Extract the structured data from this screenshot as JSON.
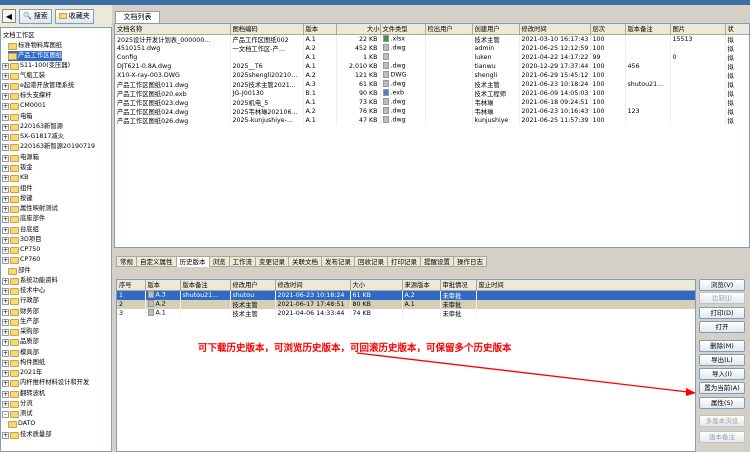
{
  "toolbar": {
    "search_label": "搜索",
    "favorites_label": "收藏夹"
  },
  "tree": [
    {
      "label": "文档工作区",
      "level": 0,
      "expander": "",
      "folder": false
    },
    {
      "label": "标准物料库图纸",
      "level": 1,
      "expander": "",
      "folder": true
    },
    {
      "label": "产品工作区图纸",
      "level": 1,
      "expander": "",
      "folder": true,
      "selected": true
    },
    {
      "label": "S11-100(变压器)",
      "level": 0,
      "expander": "+",
      "folder": true
    },
    {
      "label": "气瓶工装",
      "level": 0,
      "expander": "+",
      "folder": true
    },
    {
      "label": "e起港开放管理系统",
      "level": 0,
      "expander": "+",
      "folder": true
    },
    {
      "label": "标头支撑杆",
      "level": 0,
      "expander": "+",
      "folder": true
    },
    {
      "label": "CM0001",
      "level": 0,
      "expander": "+",
      "folder": true
    },
    {
      "label": "电箱",
      "level": 0,
      "expander": "+",
      "folder": true
    },
    {
      "label": "220163新智源",
      "level": 0,
      "expander": "+",
      "folder": true
    },
    {
      "label": "SX-G1817减火",
      "level": 0,
      "expander": "+",
      "folder": true
    },
    {
      "label": "220163新智源20190719",
      "level": 0,
      "expander": "+",
      "folder": true
    },
    {
      "label": "电源箱",
      "level": 0,
      "expander": "+",
      "folder": true
    },
    {
      "label": "钣金",
      "level": 0,
      "expander": "+",
      "folder": true
    },
    {
      "label": "KB",
      "level": 0,
      "expander": "+",
      "folder": true
    },
    {
      "label": "组件",
      "level": 0,
      "expander": "+",
      "folder": true
    },
    {
      "label": "按键",
      "level": 0,
      "expander": "+",
      "folder": true
    },
    {
      "label": "属性映射测试",
      "level": 0,
      "expander": "+",
      "folder": true
    },
    {
      "label": "底座部件",
      "level": 0,
      "expander": "+",
      "folder": true
    },
    {
      "label": "台底组",
      "level": 0,
      "expander": "+",
      "folder": true
    },
    {
      "label": "3D项目",
      "level": 0,
      "expander": "+",
      "folder": true
    },
    {
      "label": "CP750",
      "level": 0,
      "expander": "+",
      "folder": true
    },
    {
      "label": "CP760",
      "level": 0,
      "expander": "+",
      "folder": true
    },
    {
      "label": "部件",
      "level": 1,
      "expander": "",
      "folder": true
    },
    {
      "label": "系统功能资料",
      "level": 0,
      "expander": "+",
      "folder": true
    },
    {
      "label": "技术中心",
      "level": 0,
      "expander": "+",
      "folder": true
    },
    {
      "label": "行政部",
      "level": 0,
      "expander": "+",
      "folder": true
    },
    {
      "label": "财务部",
      "level": 0,
      "expander": "+",
      "folder": true
    },
    {
      "label": "生产部",
      "level": 0,
      "expander": "+",
      "folder": true
    },
    {
      "label": "采购部",
      "level": 0,
      "expander": "+",
      "folder": true
    },
    {
      "label": "品质部",
      "level": 0,
      "expander": "+",
      "folder": true
    },
    {
      "label": "模具部",
      "level": 0,
      "expander": "+",
      "folder": true
    },
    {
      "label": "构件图纸",
      "level": 0,
      "expander": "+",
      "folder": true
    },
    {
      "label": "2021年",
      "level": 0,
      "expander": "+",
      "folder": true
    },
    {
      "label": "内杆推杆材料设计和开发",
      "level": 0,
      "expander": "+",
      "folder": true
    },
    {
      "label": "翻转波机",
      "level": 0,
      "expander": "+",
      "folder": true
    },
    {
      "label": "分流",
      "level": 0,
      "expander": "+",
      "folder": true
    },
    {
      "label": "测试",
      "level": 0,
      "expander": "-",
      "folder": true
    },
    {
      "label": "DATO",
      "level": 1,
      "expander": "",
      "folder": true
    },
    {
      "label": "技术质量部",
      "level": 0,
      "expander": "+",
      "folder": true
    }
  ],
  "main_tab": "文档列表",
  "doc_columns": [
    "文档名称",
    "图档编码",
    "版本",
    "大小",
    "文件类型",
    "检出用户",
    "创建用户",
    "修改时间",
    "层次",
    "版本备注",
    "图片",
    "状"
  ],
  "doc_rows": [
    {
      "name": "2025设计开发计划表_000000...",
      "code": "产品工作区图纸002",
      "ver": "A.1",
      "size": "22 KB",
      "type": ".xlsx",
      "icon": "green",
      "checkout": "",
      "creator": "技术主管",
      "mtime": "2021-03-10 16:17:43",
      "level": "100",
      "note": "",
      "pic": "15513",
      "status": "拟"
    },
    {
      "name": "4510151.dwg",
      "code": "一文档工作区-产...",
      "ver": "A.2",
      "size": "452 KB",
      "type": ".dwg",
      "icon": "gray",
      "checkout": "",
      "creator": "admin",
      "mtime": "2021-06-25 12:12:59",
      "level": "100",
      "note": "",
      "pic": "",
      "status": "拟"
    },
    {
      "name": "Config",
      "code": "",
      "ver": "A.1",
      "size": "1 KB",
      "type": "",
      "icon": "gray",
      "checkout": "",
      "creator": "luken",
      "mtime": "2021-04-22 14:17:22",
      "level": "99",
      "note": "",
      "pic": "0",
      "status": "拟"
    },
    {
      "name": "DJT621-0.8A.dwg",
      "code": "2025__T6",
      "ver": "A.1",
      "size": "2,010 KB",
      "type": ".dwg",
      "icon": "gray",
      "checkout": "",
      "creator": "tianwu",
      "mtime": "2020-12-29 17:37:44",
      "level": "100",
      "note": "456",
      "pic": "",
      "status": "拟"
    },
    {
      "name": "X10-X-ray-003.DWG",
      "code": "2025shengli20210...",
      "ver": "A.2",
      "size": "121 KB",
      "type": "DWG",
      "icon": "gray",
      "checkout": "",
      "creator": "shengli",
      "mtime": "2021-06-29 15:45:12",
      "level": "100",
      "note": "",
      "pic": "",
      "status": "拟"
    },
    {
      "name": "产品工作区图纸011.dwg",
      "code": "2025技术主管2021...",
      "ver": "A.3",
      "size": "61 KB",
      "type": ".dwg",
      "icon": "gray",
      "checkout": "",
      "creator": "技术主管",
      "mtime": "2021-06-23 10:18:24",
      "level": "100",
      "note": "shutou21...",
      "pic": "",
      "status": "拟"
    },
    {
      "name": "产品工作区图纸020.exb",
      "code": "JG-J00130",
      "ver": "B.1",
      "size": "90 KB",
      "type": ".exb",
      "icon": "blue",
      "checkout": "",
      "creator": "技术工程师",
      "mtime": "2021-06-09 14:05:03",
      "level": "100",
      "note": "",
      "pic": "",
      "status": "拟"
    },
    {
      "name": "产品工作区图纸023.dwg",
      "code": "2025机电_5",
      "ver": "A.1",
      "size": "73 KB",
      "type": ".dwg",
      "icon": "gray",
      "checkout": "",
      "creator": "韦林琳",
      "mtime": "2021-06-18 09:24:51",
      "level": "100",
      "note": "",
      "pic": "",
      "status": "拟"
    },
    {
      "name": "产品工作区图纸024.dwg",
      "code": "2025韦林琳202106...",
      "ver": "A.2",
      "size": "76 KB",
      "type": ".dwg",
      "icon": "gray",
      "checkout": "",
      "creator": "韦林琳",
      "mtime": "2021-06-23 10:16:43",
      "level": "100",
      "note": "123",
      "pic": "",
      "status": "拟"
    },
    {
      "name": "产品工作区图纸026.dwg",
      "code": "2025-kunjushiye-...",
      "ver": "A.1",
      "size": "47 KB",
      "type": ".dwg",
      "icon": "gray",
      "checkout": "",
      "creator": "kunjushiye",
      "mtime": "2021-06-25 11:57:39",
      "level": "100",
      "note": "",
      "pic": "",
      "status": "拟"
    }
  ],
  "sub_tabs": [
    "常规",
    "自定义属性",
    "历史版本",
    "浏览",
    "工作流",
    "变更记录",
    "关联文档",
    "发布记录",
    "回收记录",
    "打印记录",
    "提醒设置",
    "操作日志"
  ],
  "active_sub_tab": 2,
  "hist_columns": [
    "序号",
    "版本",
    "版本备注",
    "修改用户",
    "修改时间",
    "大小",
    "来源版本",
    "审批情况",
    "废止时间"
  ],
  "hist_rows": [
    {
      "no": "1",
      "ver": "A.3",
      "note": "shutou21...",
      "user": "shutou",
      "mtime": "2021-06-23 10:18:24",
      "size": "61 KB",
      "src": "A.2",
      "approval": "未审批",
      "abolish": ""
    },
    {
      "no": "2",
      "ver": "A.2",
      "note": "",
      "user": "技术主管",
      "mtime": "2021-06-17 17:48:51",
      "size": "80 KB",
      "src": "A.1",
      "approval": "未审批",
      "abolish": ""
    },
    {
      "no": "3",
      "ver": "A.1",
      "note": "",
      "user": "技术主管",
      "mtime": "2021-04-06 14:33:44",
      "size": "74 KB",
      "src": "",
      "approval": "未审批",
      "abolish": ""
    }
  ],
  "annotation": "可下载历史版本，可浏览历史版本，可回滚历史版本，可保留多个历史版本",
  "side_buttons": [
    {
      "label": "浏览(V)",
      "enabled": true
    },
    {
      "label": "比较(J)",
      "enabled": false
    },
    {
      "label": "打印(D)",
      "enabled": true
    },
    {
      "label": "打开",
      "enabled": true
    },
    {
      "label": "删除(M)",
      "enabled": true
    },
    {
      "label": "导出(L)",
      "enabled": true
    },
    {
      "label": "导入(I)",
      "enabled": true
    },
    {
      "label": "置为当前(A)",
      "enabled": true
    },
    {
      "label": "属性(S)",
      "enabled": true
    },
    {
      "label": "多版本浏览",
      "enabled": false
    },
    {
      "label": "版本备注",
      "enabled": false
    }
  ]
}
